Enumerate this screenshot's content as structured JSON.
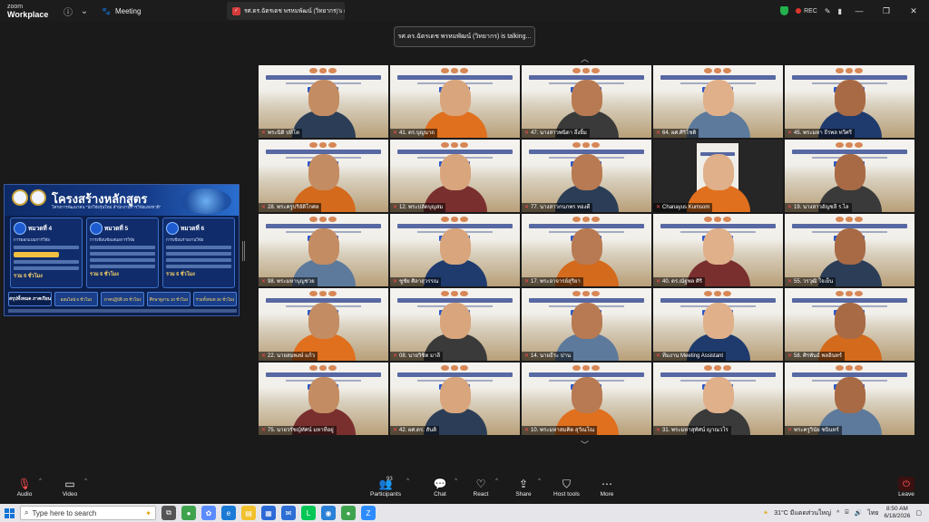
{
  "app": {
    "brand_line1": "zoom",
    "brand_line2": "Workplace",
    "meeting_tab": "Meeting"
  },
  "share_tab": {
    "title": "รศ.ดร.ฉัตรเดช พรหมพัฒน์ (วิทยากร)'s s"
  },
  "toolbar_top": {
    "rec_label": "REC"
  },
  "talking_banner": "รศ.ดร.ฉัตรเดช พรหมพัฒน์ (วิทยากร) is talking...",
  "shared_slide": {
    "title": "โครงสร้างหลักสูตร",
    "subtitle": "โครงการพัฒนาคน \"นักวิจัยรุ่นใหม่ สำนักงานการวิจัยแห่งชาติ\"",
    "modules": [
      {
        "heading": "หมวดที่ 4",
        "sub": "การออกแบบการวิจัย",
        "total": "รวม 6 ชั่วโมง"
      },
      {
        "heading": "หมวดที่ 5",
        "sub": "การเขียนข้อเสนอการวิจัย",
        "total": "รวม 6 ชั่วโมง"
      },
      {
        "heading": "หมวดที่ 6",
        "sub": "การเขียนรายงานวิจัย",
        "total": "รวม 6 ชั่วโมง"
      }
    ],
    "footer": [
      "สรุปทั้งหมด ภาคเรียน",
      "ออนไลน์ 6 ชั่วโมง",
      "ภาคปฏิบัติ 20 ชั่วโมง",
      "ศึกษาดูงาน 10 ชั่วโมง",
      "รวมทั้งหมด 36 ชั่วโมง"
    ]
  },
  "participants": [
    {
      "name": "พระนิติ ปทีโต"
    },
    {
      "name": "41. ดร.บุญนาถ"
    },
    {
      "name": "47. นางสาวพนิดา อึ่งยิ้ม"
    },
    {
      "name": "64. ผศ.ศิริโชติ"
    },
    {
      "name": "45. พระมหา ธีรพล ทวีศรี"
    },
    {
      "name": "28. พระครูปริยัติโกศล"
    },
    {
      "name": "12. พระปลัดบุญสม"
    },
    {
      "name": "77. นางสาวกนกพร ทองดี"
    },
    {
      "name": "Chanayus Kumsom"
    },
    {
      "name": "19. นางสาวอัญชลี ร.ไล"
    },
    {
      "name": "98. พระมหาบุญช่วย"
    },
    {
      "name": "ชูชัย ศิลาสุวรรณ"
    },
    {
      "name": "17. พระอาจารย์สุริยา"
    },
    {
      "name": "40. ดร.ณัฐพล ศิริ"
    },
    {
      "name": "55. วรวุฒิ ใจเย็น"
    },
    {
      "name": "22. นายสมพงษ์ แก้ว"
    },
    {
      "name": "08. นายวิชิต มาลี"
    },
    {
      "name": "14. นายธีระ ปาน"
    },
    {
      "name": "ทีมงาน Meeting Assistant"
    },
    {
      "name": "58. ศิรพันธ์ พลอินทร์"
    },
    {
      "name": "75. นายวรัชญ์ทัศน์ มหาทีอยู่"
    },
    {
      "name": "42. ผศ.ดร. สันติ"
    },
    {
      "name": "10. พระมหาสมคิด สุวัณโณ"
    },
    {
      "name": "31. พระมหาสุทัศน์ ญาณวโร"
    },
    {
      "name": "พระครูวินัย ชนินทร์"
    }
  ],
  "toolbar": {
    "audio": "Audio",
    "video": "Video",
    "participants": "Participants",
    "participants_count": "93",
    "chat": "Chat",
    "react": "React",
    "share": "Share",
    "host_tools": "Host tools",
    "more": "More",
    "leave": "Leave"
  },
  "taskbar": {
    "search_placeholder": "Type here to search",
    "weather": "31°C มีแดดส่วนใหญ่",
    "lang": "ไทย",
    "time": "8:50 AM",
    "date": "6/18/2026"
  }
}
